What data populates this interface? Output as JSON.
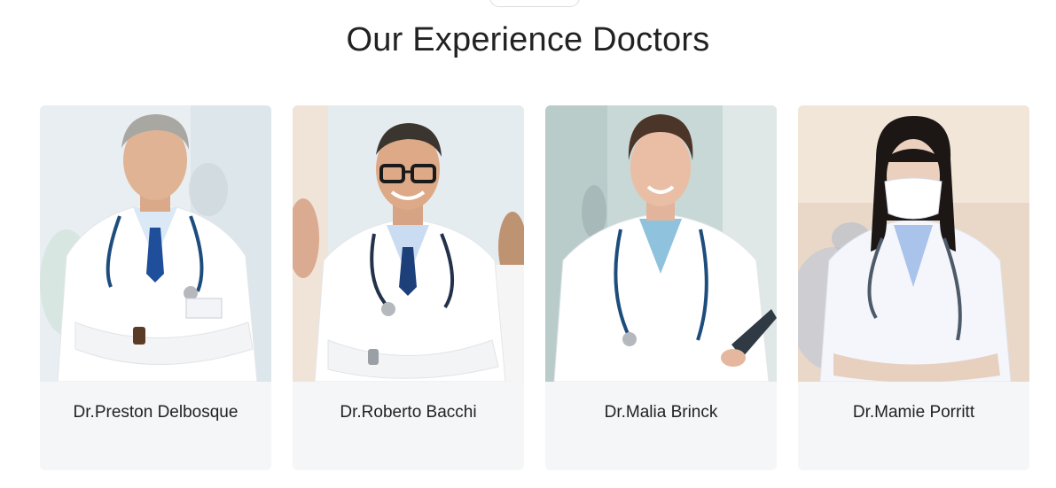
{
  "section": {
    "title": "Our Experience Doctors"
  },
  "doctors": [
    {
      "name": "Dr.Preston Delbosque",
      "photo": "doctor-photo-male-gray-hair",
      "bg_color": "#e8eef2",
      "coat_color": "#ffffff",
      "tie_color": "#1f4e9a"
    },
    {
      "name": "Dr.Roberto Bacchi",
      "photo": "doctor-photo-male-glasses",
      "bg_color": "#e4ecef",
      "coat_color": "#ffffff",
      "tie_color": "#1d3f7a"
    },
    {
      "name": "Dr.Malia Brinck",
      "photo": "doctor-photo-female-smiling",
      "bg_color": "#c7d8d6",
      "coat_color": "#ffffff",
      "tie_color": "#8ec2dd"
    },
    {
      "name": "Dr.Mamie Porritt",
      "photo": "doctor-photo-female-mask",
      "bg_color": "#e9d8c8",
      "coat_color": "#f4f6fb",
      "tie_color": "#a9c3ea"
    }
  ]
}
